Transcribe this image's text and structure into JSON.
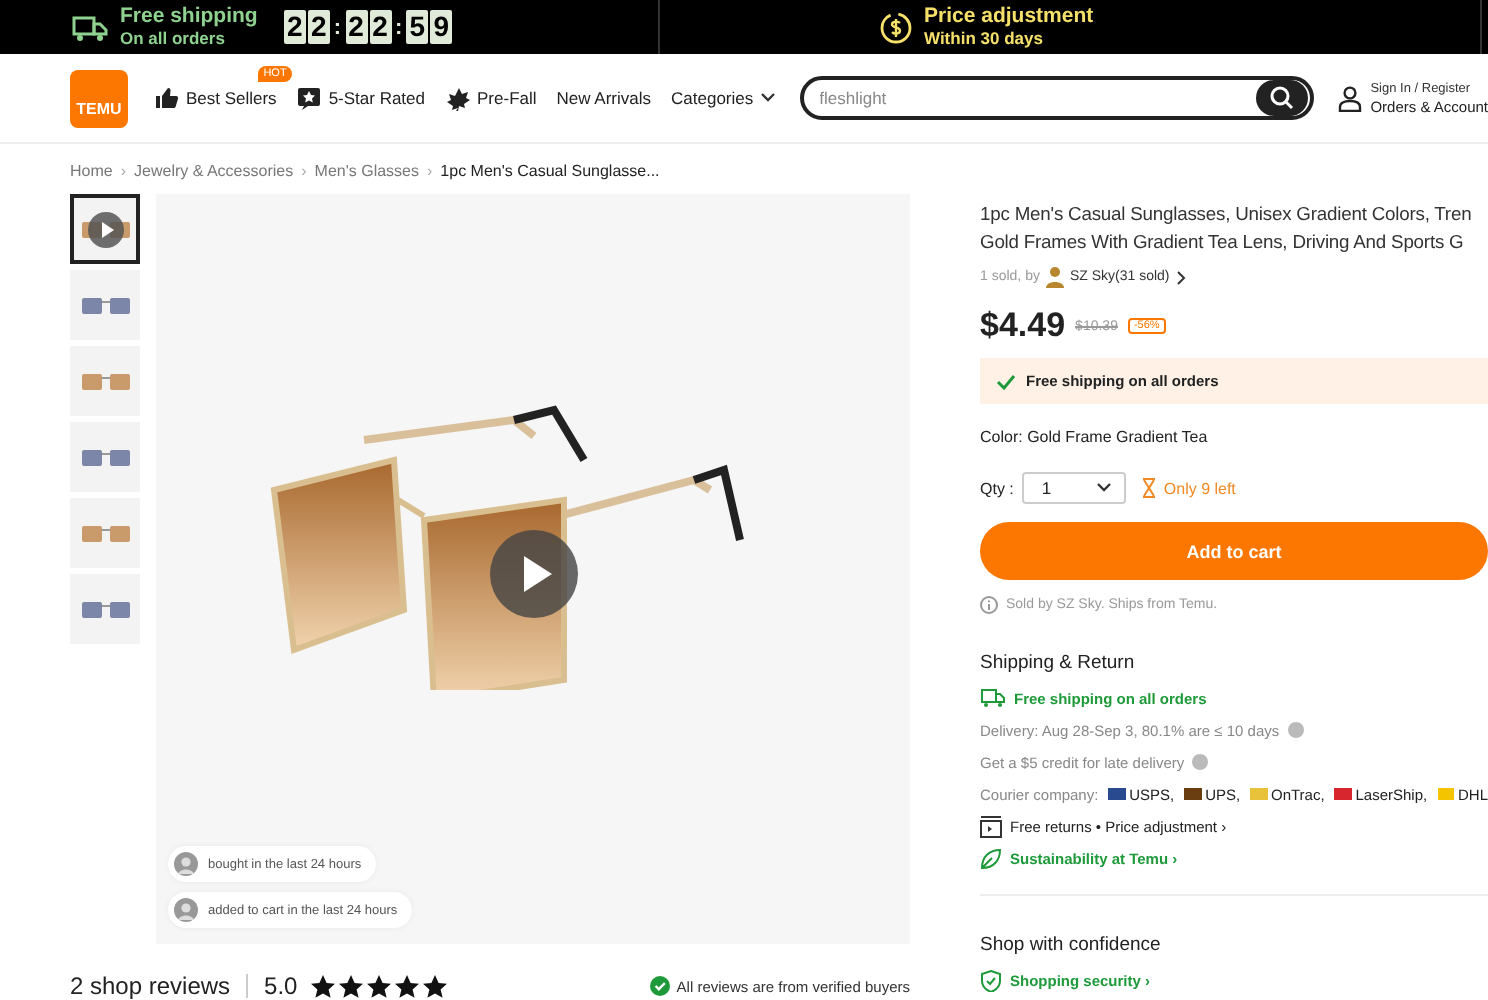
{
  "promo_bar": {
    "shipping_title": "Free shipping",
    "shipping_sub": "On all orders",
    "timer": [
      "2",
      "2",
      ":",
      "2",
      "2",
      ":",
      "5",
      "9"
    ],
    "price_title": "Price adjustment",
    "price_sub": "Within 30 days"
  },
  "header": {
    "logo": "TEMU",
    "nav": [
      {
        "label": "Best Sellers",
        "badge": "HOT",
        "kind": "bestseller"
      },
      {
        "label": "5-Star Rated",
        "kind": "rated"
      },
      {
        "label": "Pre-Fall",
        "kind": "seasonal"
      },
      {
        "label": "New Arrivals",
        "kind": "plain"
      },
      {
        "label": "Categories",
        "kind": "dropdown"
      }
    ],
    "search": {
      "placeholder": "fleshlight"
    },
    "account": {
      "line1": "Sign In / Register",
      "line2": "Orders & Account"
    }
  },
  "breadcrumb": [
    {
      "label": "Home",
      "separator": "›"
    },
    {
      "label": "Jewelry & Accessories",
      "separator": "›"
    },
    {
      "label": "Men's Glasses",
      "separator": "›"
    },
    {
      "label": "1pc Men's Casual Sunglasse..."
    }
  ],
  "gallery": {
    "thumbnails": [
      {
        "selected": true,
        "video": true
      },
      {
        "selected": false
      },
      {
        "selected": false
      },
      {
        "selected": false
      },
      {
        "selected": false
      },
      {
        "selected": false
      }
    ],
    "social": [
      "bought in the last 24 hours",
      "added to cart in the last 24 hours"
    ]
  },
  "reviews": {
    "count": "2 shop reviews",
    "rating": "5.0",
    "stars": 5,
    "verified": "All reviews are from verified buyers"
  },
  "product": {
    "title_lines": [
      "1pc Men's Casual Sunglasses, Unisex Gradient Colors, Tren",
      "Gold Frames With Gradient Tea Lens, Driving And Sports G"
    ],
    "sold": "1 sold, by",
    "seller": "SZ Sky(31 sold)",
    "price": "$4.49",
    "old_price": "$10.39",
    "discount": "-56%",
    "shipping_note": "Free shipping on all orders",
    "color_label": "Color: Gold Frame Gradient Tea",
    "qty_label": "Qty :",
    "qty": "1",
    "stock": "Only 9 left",
    "add_to_cart": "Add to cart",
    "sold_by": "Sold by SZ Sky. Ships from Temu."
  },
  "shipping": {
    "heading": "Shipping & Return",
    "free": "Free shipping on all orders",
    "delivery": "Delivery: Aug 28-Sep 3, 80.1% are ≤ 10 days",
    "credit": "Get a $5 credit for late delivery",
    "courier_label": "Courier company:",
    "couriers": [
      {
        "name": "USPS,",
        "color": "#2a4a8f"
      },
      {
        "name": "UPS,",
        "color": "#6b3e12"
      },
      {
        "name": "OnTrac,",
        "color": "#e8c23a"
      },
      {
        "name": "LaserShip,",
        "color": "#d7262e"
      },
      {
        "name": "DHL",
        "color": "#f5c400"
      }
    ],
    "returns": "Free returns • Price adjustment ›",
    "sustainability": "Sustainability at Temu ›"
  },
  "confidence": {
    "heading": "Shop with confidence",
    "security": "Shopping security ›"
  }
}
